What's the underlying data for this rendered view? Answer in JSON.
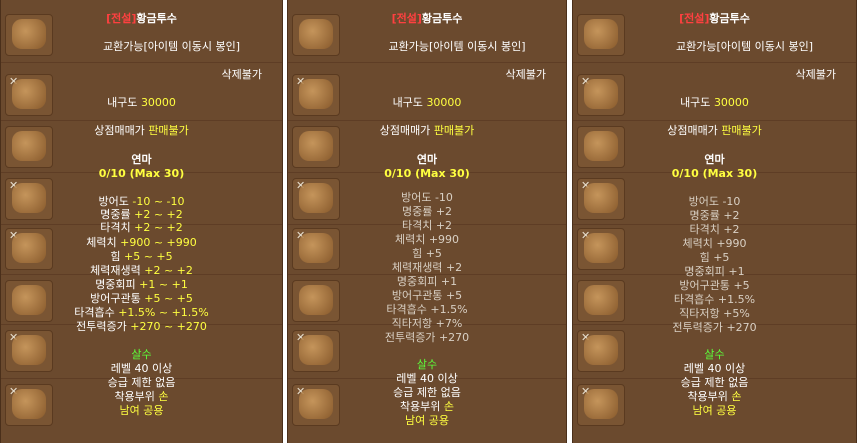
{
  "panels": [
    {
      "title_prefix": "[전설]",
      "title_name": "황금투수",
      "trade": "교환가능[아이템 이동시 봉인]",
      "no_delete": "삭제불가",
      "durability_label": "내구도",
      "durability_value": "30000",
      "shop_label": "상점매매가",
      "shop_value": "판매불가",
      "enhance_title": "연마",
      "enhance_progress": "0/10 (Max 30)",
      "stats": [
        {
          "name": "방어도",
          "value": "-10 ~ -10"
        },
        {
          "name": "명중률",
          "value": "+2 ~ +2"
        },
        {
          "name": "타격치",
          "value": "+2 ~ +2"
        },
        {
          "name": "체력치",
          "value": "+900 ~ +990"
        },
        {
          "name": "힘",
          "value": "+5 ~ +5"
        },
        {
          "name": "체력재생력",
          "value": "+2 ~ +2"
        },
        {
          "name": "명중회피",
          "value": "+1 ~ +1"
        },
        {
          "name": "방어구관통",
          "value": "+5 ~ +5"
        },
        {
          "name": "타격흡수",
          "value": "+1.5% ~ +1.5%"
        },
        {
          "name": "전투력증가",
          "value": "+270 ~ +270"
        }
      ],
      "class_name": "살수",
      "level_req": "레벨 40 이상",
      "promo": "승급 제한 없음",
      "slot_label": "착용부위",
      "slot_value": "손",
      "gender": "남여 공용"
    },
    {
      "title_prefix": "[전설]",
      "title_name": "황금투수",
      "trade": "교환가능[아이템 이동시 봉인]",
      "no_delete": "삭제불가",
      "durability_label": "내구도",
      "durability_value": "30000",
      "shop_label": "상점매매가",
      "shop_value": "판매불가",
      "enhance_title": "연마",
      "enhance_progress": "0/10 (Max 30)",
      "stats": [
        {
          "name": "방어도",
          "value": "-10"
        },
        {
          "name": "명중률",
          "value": "+2"
        },
        {
          "name": "타격치",
          "value": "+2"
        },
        {
          "name": "체력치",
          "value": "+990"
        },
        {
          "name": "힘",
          "value": "+5"
        },
        {
          "name": "체력재생력",
          "value": "+2"
        },
        {
          "name": "명중회피",
          "value": "+1"
        },
        {
          "name": "방어구관통",
          "value": "+5"
        },
        {
          "name": "타격흡수",
          "value": "+1.5%"
        },
        {
          "name": "직타저항",
          "value": "+7%"
        },
        {
          "name": "전투력증가",
          "value": "+270"
        }
      ],
      "class_name": "살수",
      "level_req": "레벨 40 이상",
      "promo": "승급 제한 없음",
      "slot_label": "착용부위",
      "slot_value": "손",
      "gender": "남여 공용"
    },
    {
      "title_prefix": "[전설]",
      "title_name": "황금투수",
      "trade": "교환가능[아이템 이동시 봉인]",
      "no_delete": "삭제불가",
      "durability_label": "내구도",
      "durability_value": "30000",
      "shop_label": "상점매매가",
      "shop_value": "판매불가",
      "enhance_title": "연마",
      "enhance_progress": "0/10 (Max 30)",
      "stats": [
        {
          "name": "방어도",
          "value": "-10"
        },
        {
          "name": "명중률",
          "value": "+2"
        },
        {
          "name": "타격치",
          "value": "+2"
        },
        {
          "name": "체력치",
          "value": "+990"
        },
        {
          "name": "힘",
          "value": "+5"
        },
        {
          "name": "명중회피",
          "value": "+1"
        },
        {
          "name": "방어구관통",
          "value": "+5"
        },
        {
          "name": "타격흡수",
          "value": "+1.5%"
        },
        {
          "name": "직타저항",
          "value": "+5%"
        },
        {
          "name": "전투력증가",
          "value": "+270"
        }
      ],
      "class_name": "살수",
      "level_req": "레벨 40 이상",
      "promo": "승급 제한 없음",
      "slot_label": "착용부위",
      "slot_value": "손",
      "gender": "남여 공용"
    }
  ],
  "colors": {
    "panel_bg": "#6b4a2e",
    "legend_red": "#ff4040",
    "value_yellow": "#ffff40",
    "class_green": "#5dff3a"
  }
}
